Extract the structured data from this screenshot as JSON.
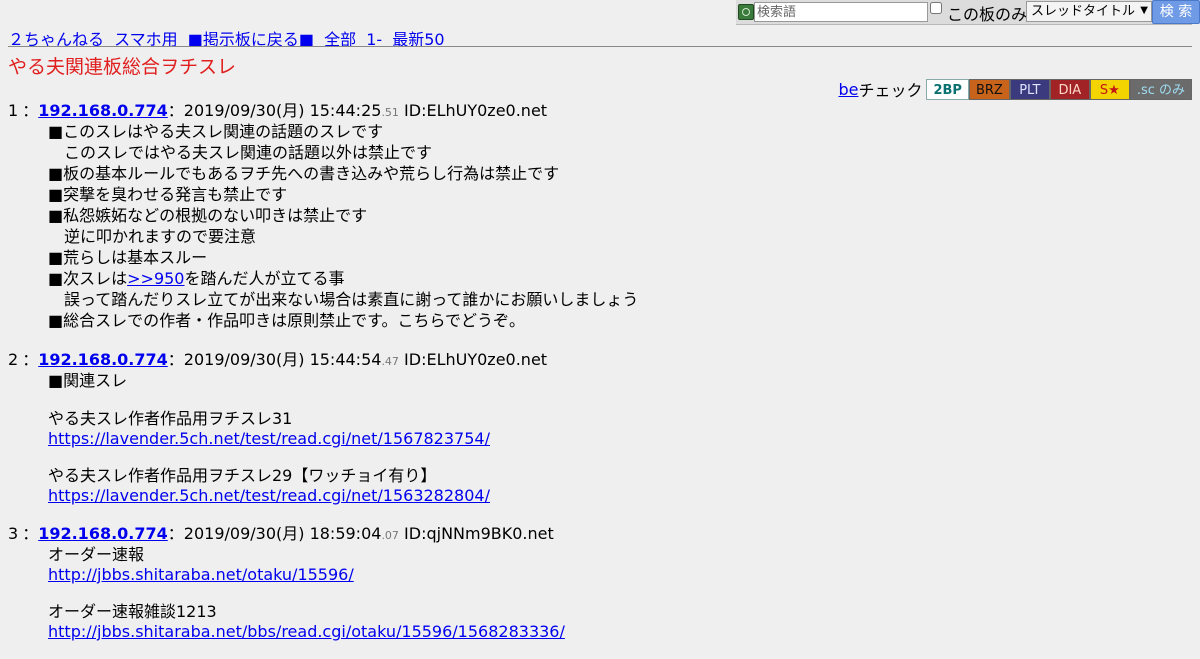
{
  "search": {
    "placeholder": "検索語",
    "board_only_label": "この板のみ",
    "mode_selected": "スレッドタイトル",
    "button_label": "検 索"
  },
  "nav": {
    "items": [
      "２ちゃんねる",
      "スマホ用",
      "■掲示板に戻る■",
      "全部",
      "1-",
      "最新50"
    ]
  },
  "thread": {
    "title": "やる夫関連板総合ヲチスレ"
  },
  "becheck": {
    "be_link": "be",
    "label": "チェック",
    "buttons": [
      "2BP",
      "BRZ",
      "PLT",
      "DIA",
      "S★",
      ".sc のみ"
    ]
  },
  "posts": [
    {
      "num": "1",
      "sep": "：",
      "name": "192.168.0.774",
      "date": "2019/09/30(月) 15:44:25",
      "ms": ".51",
      "id": "ID:ELhUY0ze0.net",
      "lines": [
        "■このスレはやる夫スレ関連の話題のスレです",
        "このスレではやる夫スレ関連の話題以外は禁止です",
        "■板の基本ルールでもあるヲチ先への書き込みや荒らし行為は禁止です",
        "■突撃を臭わせる発言も禁止です",
        "■私怨嫉妬などの根拠のない叩きは禁止です",
        "逆に叩かれますので要注意",
        "■荒らしは基本スルー",
        "■次スレは",
        ">>950",
        "を踏んだ人が立てる事",
        "誤って踏んだりスレ立てが出来ない場合は素直に謝って誰かにお願いしましょう",
        "■総合スレでの作者・作品叩きは原則禁止です。こちらでどうぞ。"
      ]
    },
    {
      "num": "2",
      "sep": "：",
      "name": "192.168.0.774",
      "date": "2019/09/30(月) 15:44:54",
      "ms": ".47",
      "id": "ID:ELhUY0ze0.net",
      "lines": [
        "■関連スレ",
        "やる夫スレ作者作品用ヲチスレ31",
        "https://lavender.5ch.net/test/read.cgi/net/1567823754/",
        "やる夫スレ作者作品用ヲチスレ29【ワッチョイ有り】",
        "https://lavender.5ch.net/test/read.cgi/net/1563282804/"
      ]
    },
    {
      "num": "3",
      "sep": "：",
      "name": "192.168.0.774",
      "date": "2019/09/30(月) 18:59:04",
      "ms": ".07",
      "id": "ID:qjNNm9BK0.net",
      "lines": [
        "オーダー速報",
        "http://jbbs.shitaraba.net/otaku/15596/",
        "オーダー速報雑談1213",
        "http://jbbs.shitaraba.net/bbs/read.cgi/otaku/15596/1568283336/"
      ]
    }
  ]
}
